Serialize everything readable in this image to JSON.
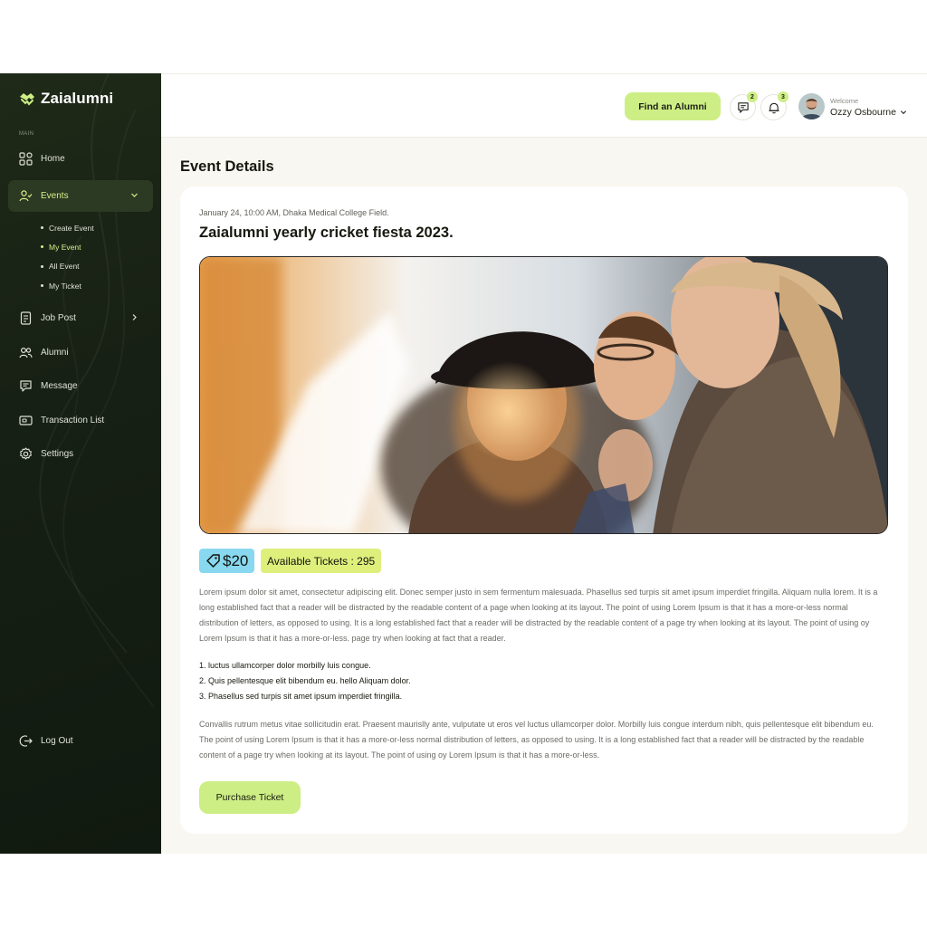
{
  "brand": {
    "name": "Zaialumni"
  },
  "sidebar": {
    "section_label": "MAIN",
    "items": [
      {
        "label": "Home",
        "icon": "grid-icon"
      },
      {
        "label": "Events",
        "icon": "user-event-icon"
      },
      {
        "label": "Job Post",
        "icon": "document-icon"
      },
      {
        "label": "Alumni",
        "icon": "users-icon"
      },
      {
        "label": "Message",
        "icon": "message-icon"
      },
      {
        "label": "Transaction List",
        "icon": "wallet-icon"
      },
      {
        "label": "Settings",
        "icon": "gear-icon"
      }
    ],
    "sub_items": [
      {
        "label": "Create Event"
      },
      {
        "label": "My Event"
      },
      {
        "label": "All Event"
      },
      {
        "label": "My Ticket"
      }
    ],
    "logout": "Log Out"
  },
  "header": {
    "find_button": "Find an Alumni",
    "messages_count": "2",
    "notifications_count": "3",
    "welcome": "Welcome",
    "user_name": "Ozzy Osbourne"
  },
  "page": {
    "title": "Event Details"
  },
  "event": {
    "meta": "January 24, 10:00 AM, Dhaka Medical College Field.",
    "title": "Zaialumni yearly cricket fiesta 2023.",
    "price": "$20",
    "available_tickets": "Available Tickets : 295",
    "paragraph1": "Lorem ipsum dolor sit amet, consectetur adipiscing elit. Donec semper justo in sem fermentum malesuada. Phasellus sed turpis sit amet ipsum imperdiet fringilla. Aliquam nulla lorem. It is a long established fact that a reader will be distracted by the readable content of a page when looking at its layout. The point of using Lorem Ipsum is that it has a more-or-less normal distribution of letters, as opposed to using. It is a long established fact that a reader will be distracted by the readable content of a page try when looking at its layout. The point of using oy Lorem Ipsum is that it has a more-or-less. page try when looking at fact that a reader.",
    "list": [
      "1. luctus ullamcorper dolor morbilly luis congue.",
      "2. Quis pellentesque elit bibendum eu. hello Aliquam dolor.",
      "3. Phasellus sed turpis sit amet ipsum imperdiet fringilla."
    ],
    "paragraph2": "Convallis rutrum metus vitae sollicitudin erat. Praesent maurislly ante, vulputate ut eros vel luctus ullamcorper dolor. Morbilly luis congue interdum nibh, quis pellentesque elit bibendum eu. The point of using Lorem Ipsum is that it has a more-or-less normal distribution of letters, as opposed to using. It is a long established fact that a reader will be distracted by the readable content of a page try when looking at its layout. The point of using oy Lorem Ipsum is that it has a more-or-less.",
    "purchase_button": "Purchase Ticket"
  },
  "colors": {
    "accent": "#cdee85",
    "sidebar_bg": "#172014",
    "price_chip": "#88d8ef",
    "tickets_chip": "#dfef7c"
  }
}
